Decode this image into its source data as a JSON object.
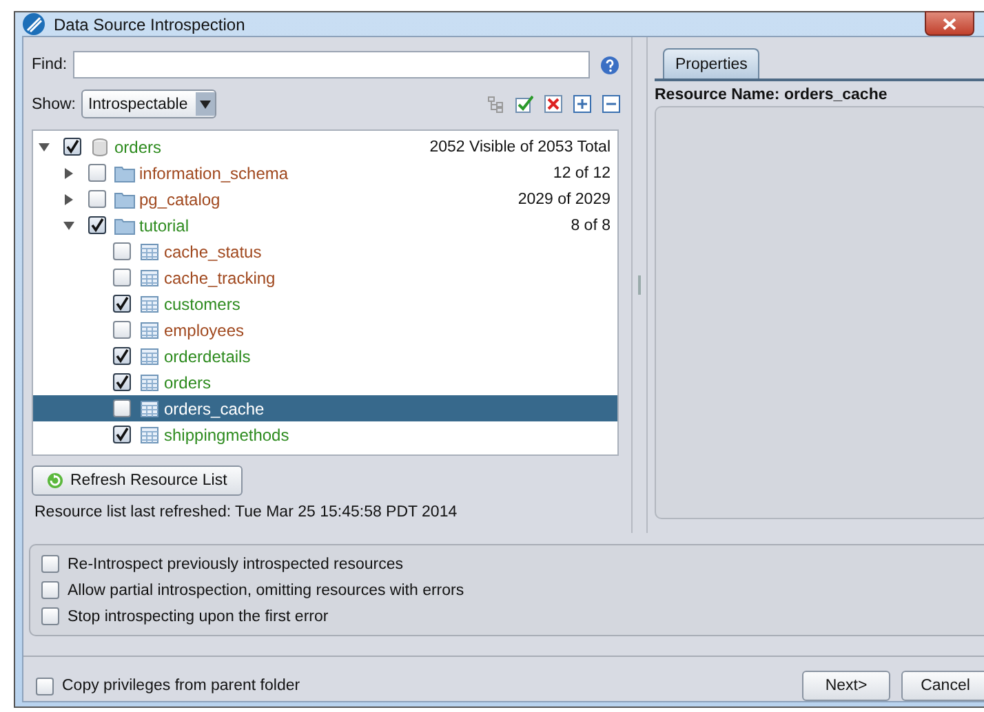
{
  "window": {
    "title": "Data Source Introspection"
  },
  "find": {
    "label": "Find:"
  },
  "show": {
    "label": "Show:",
    "value": "Introspectable"
  },
  "tree": {
    "kind": "database",
    "name": "orders",
    "count": "2052 Visible of 2053 Total",
    "checked": true,
    "expanded": true,
    "selected": false,
    "children": [
      {
        "kind": "folder",
        "name": "information_schema",
        "count": "12 of 12",
        "checked": false,
        "expanded": false,
        "selected": false
      },
      {
        "kind": "folder",
        "name": "pg_catalog",
        "count": "2029 of 2029",
        "checked": false,
        "expanded": false,
        "selected": false
      },
      {
        "kind": "folder",
        "name": "tutorial",
        "count": "8 of 8",
        "checked": true,
        "expanded": true,
        "selected": false,
        "children": [
          {
            "kind": "table",
            "name": "cache_status",
            "checked": false,
            "selected": false
          },
          {
            "kind": "table",
            "name": "cache_tracking",
            "checked": false,
            "selected": false
          },
          {
            "kind": "table",
            "name": "customers",
            "checked": true,
            "selected": false
          },
          {
            "kind": "table",
            "name": "employees",
            "checked": false,
            "selected": false
          },
          {
            "kind": "table",
            "name": "orderdetails",
            "checked": true,
            "selected": false
          },
          {
            "kind": "table",
            "name": "orders",
            "checked": true,
            "selected": false
          },
          {
            "kind": "table",
            "name": "orders_cache",
            "checked": false,
            "selected": true
          },
          {
            "kind": "table",
            "name": "shippingmethods",
            "checked": true,
            "selected": false
          }
        ]
      }
    ]
  },
  "refresh_button": "Refresh Resource List",
  "status": "Resource list last refreshed: Tue Mar 25 15:45:58 PDT 2014",
  "properties": {
    "tab": {
      "label": "Properties",
      "selected": true
    },
    "resource_name": "Resource Name: orders_cache"
  },
  "options": [
    {
      "label": "Re-Introspect previously introspected resources",
      "checked": false
    },
    {
      "label": "Allow partial introspection, omitting resources with errors",
      "checked": false
    },
    {
      "label": "Stop introspecting upon the first error",
      "checked": false
    }
  ],
  "copy_privileges": {
    "label": "Copy privileges from parent folder",
    "checked": false
  },
  "buttons": [
    "Next>",
    "Cancel"
  ]
}
